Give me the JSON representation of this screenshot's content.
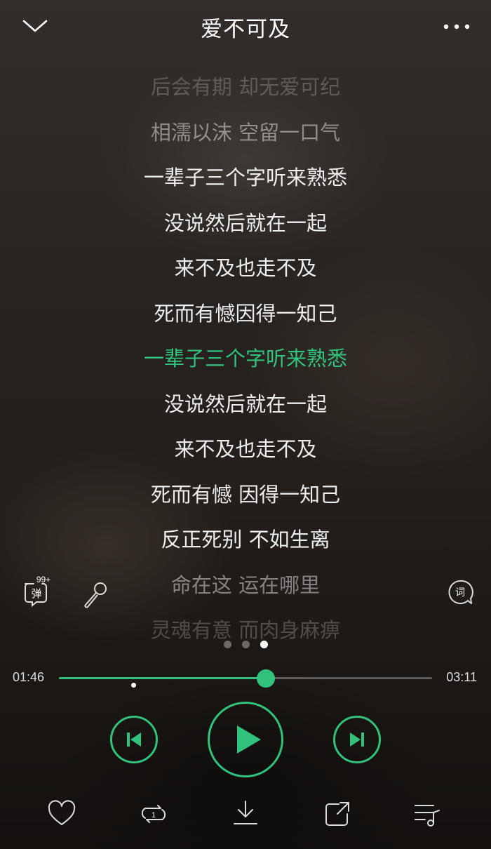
{
  "header": {
    "title": "爱不可及"
  },
  "lyrics": [
    {
      "text": "后会有期 却无爱可纪",
      "state": "dim2"
    },
    {
      "text": "相濡以沫 空留一口气",
      "state": "dim1"
    },
    {
      "text": "一辈子三个字听来熟悉",
      "state": "normal"
    },
    {
      "text": "没说然后就在一起",
      "state": "normal"
    },
    {
      "text": "来不及也走不及",
      "state": "normal"
    },
    {
      "text": "死而有憾因得一知己",
      "state": "normal"
    },
    {
      "text": "一辈子三个字听来熟悉",
      "state": "active"
    },
    {
      "text": "没说然后就在一起",
      "state": "normal"
    },
    {
      "text": "来不及也走不及",
      "state": "normal"
    },
    {
      "text": "死而有憾 因得一知己",
      "state": "normal"
    },
    {
      "text": "反正死别 不如生离",
      "state": "normal"
    },
    {
      "text": "命在这 运在哪里",
      "state": "dim1"
    },
    {
      "text": "灵魂有意 而肉身麻痹",
      "state": "dim2"
    }
  ],
  "side": {
    "danmaku_label": "弹",
    "danmaku_count": "99+",
    "lyric_label": "词"
  },
  "pager": {
    "count": 3,
    "active_index": 2
  },
  "player": {
    "current_time": "01:46",
    "total_time": "03:11",
    "progress_fraction": 0.555,
    "marker_fraction": 0.2
  },
  "colors": {
    "accent": "#31c27c"
  },
  "icons": {
    "back": "chevron-down-icon",
    "more": "more-dots-icon",
    "danmaku": "danmaku-icon",
    "mic": "microphone-icon",
    "lyric": "lyric-icon",
    "prev": "previous-track-icon",
    "play": "play-icon",
    "next": "next-track-icon",
    "like": "heart-icon",
    "loop": "repeat-one-icon",
    "download": "download-icon",
    "share": "share-icon",
    "playlist": "playlist-icon"
  }
}
